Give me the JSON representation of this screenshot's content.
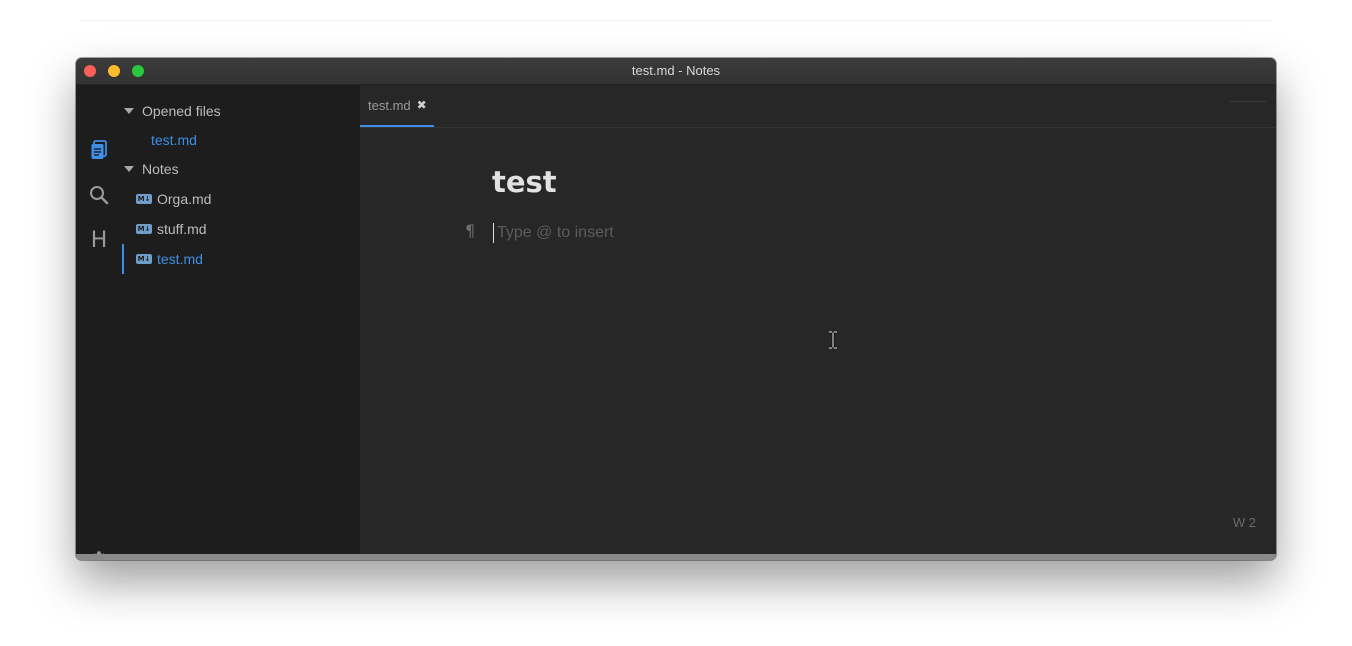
{
  "window": {
    "title": "test.md - Notes"
  },
  "activity_bar": {
    "items": [
      {
        "icon": "files-icon"
      },
      {
        "icon": "search-icon"
      },
      {
        "icon": "headings-icon",
        "glyph": "H"
      },
      {
        "icon": "gear-icon"
      }
    ]
  },
  "sidebar": {
    "opened_files": {
      "header": "Opened files",
      "items": [
        "test.md"
      ]
    },
    "notes": {
      "header": "Notes",
      "items": [
        "Orga.md",
        "stuff.md",
        "test.md"
      ],
      "active": "test.md"
    },
    "md_badge": "M↓"
  },
  "editor": {
    "tab": {
      "label": "test.md",
      "close_glyph": "✖"
    },
    "heading": "test",
    "pilcrow": "¶",
    "placeholder": "Type @ to insert",
    "word_count": "W 2"
  },
  "colors": {
    "accent": "#3d8ee6",
    "sidebar_bg": "#1d1d1d",
    "editor_bg": "#272727"
  }
}
